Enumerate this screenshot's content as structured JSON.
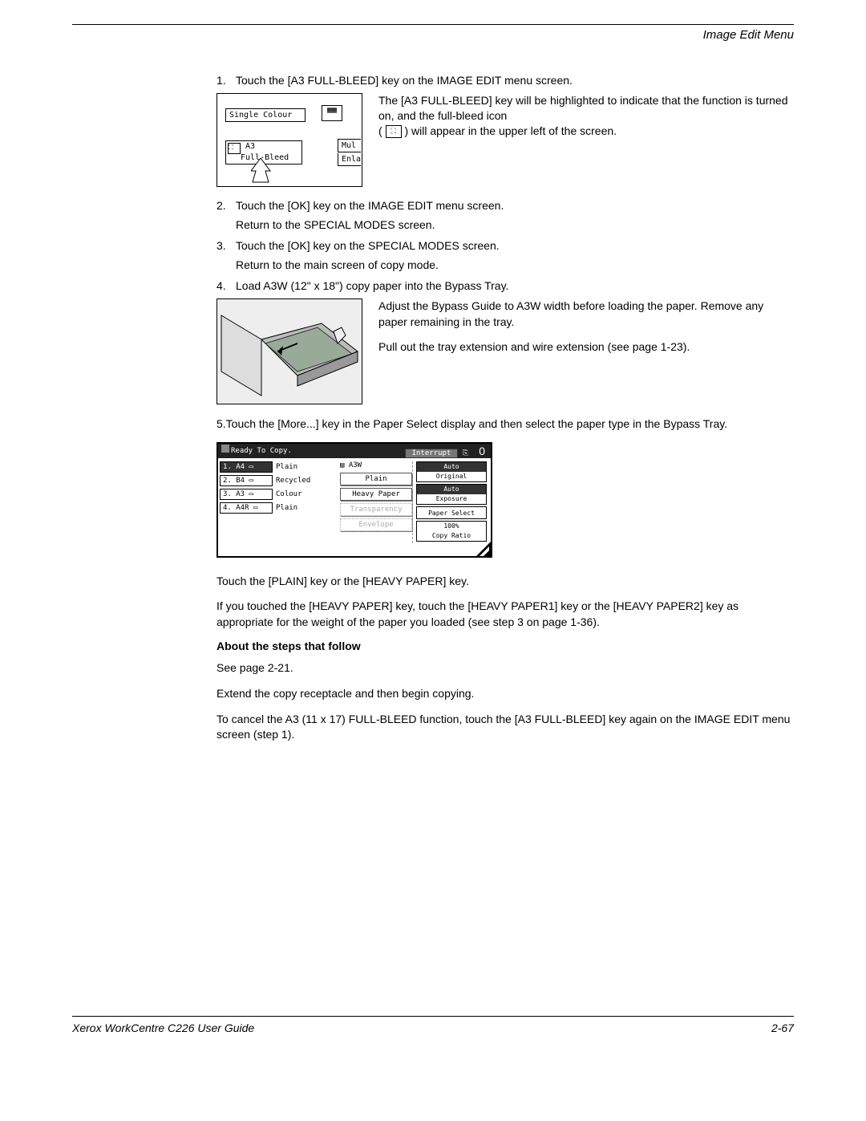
{
  "header": {
    "section": "Image Edit Menu"
  },
  "steps": {
    "s1": {
      "num": "1.",
      "text": "Touch the [A3 FULL-BLEED] key on the IMAGE EDIT menu screen."
    },
    "s1_screen": {
      "btn_single": "Single Colour",
      "btn_a3_line1": "A3",
      "btn_a3_line2": "Full-Bleed",
      "btn_mul": "Mul",
      "btn_enla": "Enla"
    },
    "s1_right": {
      "p1a": "The [A3 FULL-BLEED] key will be highlighted to indicate that the function is turned on, and the full-bleed icon",
      "p1b": ") will appear in the upper left of the screen."
    },
    "s2": {
      "num": "2.",
      "text": "Touch the [OK] key on the IMAGE EDIT menu screen."
    },
    "s2_sub": "Return to the SPECIAL MODES screen.",
    "s3": {
      "num": "3.",
      "text": "Touch the [OK] key on the SPECIAL MODES screen."
    },
    "s3_sub": "Return to the main screen of copy mode.",
    "s4": {
      "num": "4.",
      "text": "Load A3W (12\" x 18\") copy paper into the Bypass Tray."
    },
    "s4_right": {
      "p1": "Adjust the Bypass Guide to A3W width before loading the paper. Remove any paper remaining in the tray.",
      "p2": "Pull out the tray extension and wire extension (see page 1-23)."
    },
    "s5": "5.Touch the [More...] key in the Paper Select display and then select the paper type in the Bypass Tray."
  },
  "wide_screen": {
    "status": "Ready To Copy.",
    "interrupt": "Interrupt",
    "zero": "0",
    "trays": [
      {
        "num": "1.",
        "size": "A4",
        "type": "Plain",
        "sel": true
      },
      {
        "num": "2.",
        "size": "B4",
        "type": "Recycled",
        "sel": false
      },
      {
        "num": "3.",
        "size": "A3",
        "type": "Colour",
        "sel": false
      },
      {
        "num": "4.",
        "size": "A4R",
        "type": "Plain",
        "sel": false
      }
    ],
    "bypass_label": "A3W",
    "bypass_btns": [
      "Plain",
      "Heavy Paper",
      "Transparency",
      "Envelope"
    ],
    "side": [
      {
        "l1": "Auto",
        "l2": "Original",
        "sel": true
      },
      {
        "l1": "Auto",
        "l2": "Exposure",
        "sel": true
      },
      {
        "l1": "",
        "l2": "Paper Select",
        "sel": false
      },
      {
        "l1": "100%",
        "l2": "Copy Ratio",
        "sel": false
      }
    ]
  },
  "after": {
    "p1": "Touch the [PLAIN] key or the [HEAVY PAPER] key.",
    "p2": "If you touched the [HEAVY PAPER] key, touch the [HEAVY PAPER1] key or the [HEAVY PAPER2] key as appropriate for the weight of the paper you loaded (see step 3 on page 1-36).",
    "head": "About the steps that follow",
    "p3": "See page 2-21.",
    "p4": "Extend the copy receptacle and then begin copying.",
    "p5": "To cancel the A3 (11 x 17) FULL-BLEED function, touch the [A3 FULL-BLEED] key again on the IMAGE EDIT menu screen (step 1)."
  },
  "footer": {
    "left": "Xerox WorkCentre C226 User Guide",
    "right": "2-67"
  }
}
